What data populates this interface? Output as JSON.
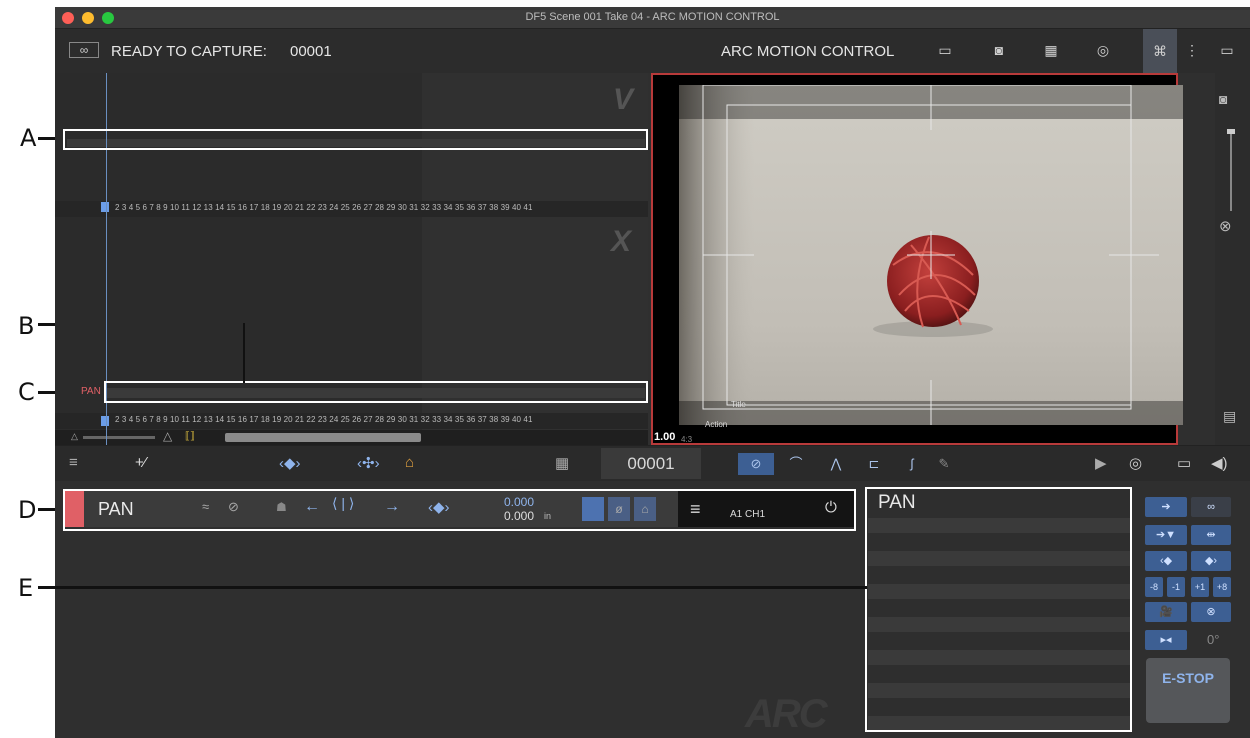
{
  "window": {
    "title": "DF5  Scene 001  Take 04 - ARC MOTION CONTROL"
  },
  "header": {
    "status_label": "READY TO CAPTURE:",
    "frame_number": "00001",
    "app_name": "ARC MOTION CONTROL"
  },
  "timeline": {
    "upper_letter": "V",
    "lower_letter": "X",
    "ruler_ticks": "2 3 4 5 6 7 8 9 10 11 12 13 14 15 16 17 18 19 20 21 22 23 24 25 26 27 28 29 30 31 32 33 34 35 36 37 38 39 40 41",
    "track_label": "PAN"
  },
  "viewer": {
    "zoom": "1.00",
    "aspect": "4:3",
    "overlay_title": "Title",
    "overlay_action": "Action"
  },
  "toolbar": {
    "frame_display": "00001"
  },
  "axis_row": {
    "name": "PAN",
    "value_main": "0.000",
    "value_in": "0.000",
    "value_unit": "in",
    "channel": "A1 CH1"
  },
  "pan_panel": {
    "title": "PAN"
  },
  "controls": {
    "step_minus8": "-8",
    "step_minus1": "-1",
    "step_plus1": "+1",
    "step_plus8": "+8",
    "angle": "0°",
    "estop": "E-STOP"
  },
  "logo": "ARC",
  "annotations": {
    "a": "A",
    "b": "B",
    "c": "C",
    "d": "D",
    "e": "E"
  },
  "colors": {
    "accent_blue": "#3d5f93",
    "track_red": "#e06066",
    "viewer_border": "#b83a3a"
  }
}
